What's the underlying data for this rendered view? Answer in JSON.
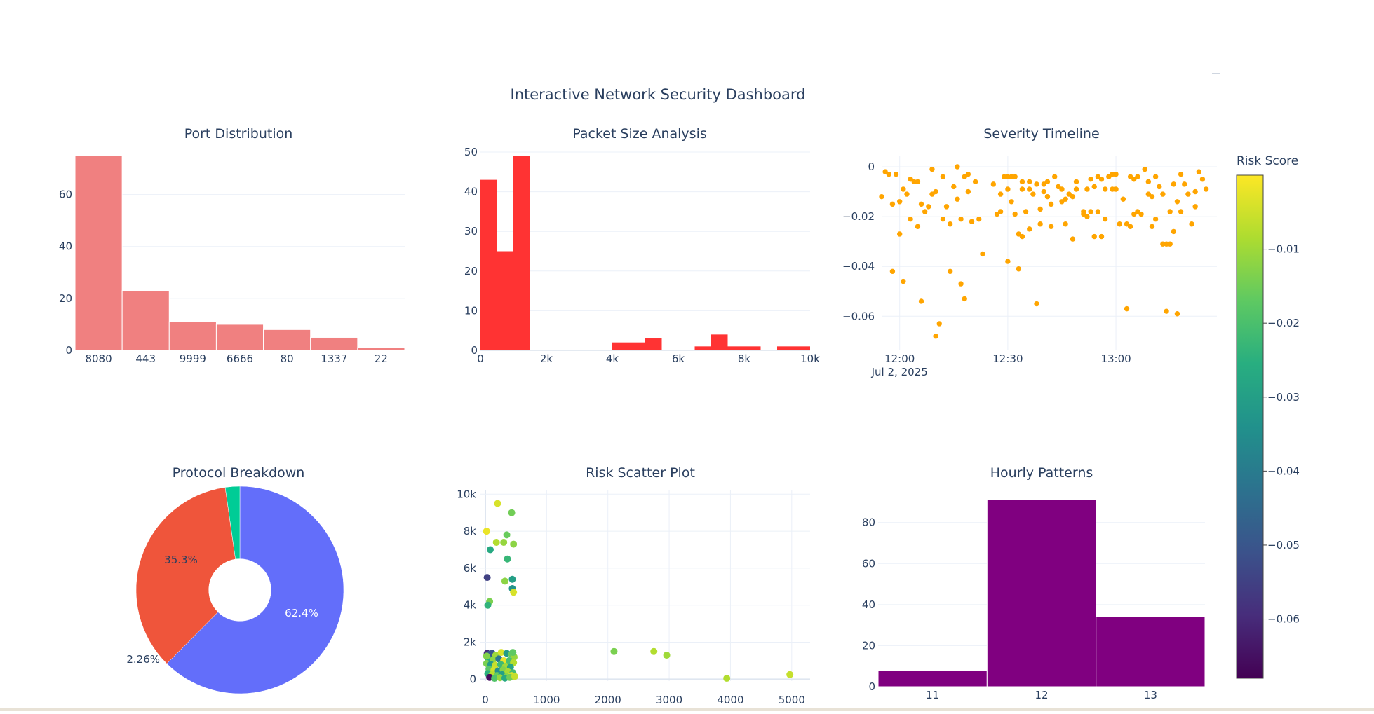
{
  "dashboard": {
    "title": "Interactive Network Security Dashboard",
    "colors": {
      "text": "#2a3f5f",
      "grid": "#ebf0f8",
      "port_bar": "#f08080",
      "packet_bar": "#ff3333",
      "severity_point": "orange",
      "hourly_bar": "purple",
      "pie": [
        "#636efa",
        "#ef553b",
        "#00cc96"
      ]
    }
  },
  "chart_data": [
    {
      "type": "bar",
      "title": "Port Distribution",
      "categories": [
        "8080",
        "443",
        "9999",
        "6666",
        "80",
        "1337",
        "22"
      ],
      "values": [
        75,
        23,
        11,
        10,
        8,
        5,
        1
      ],
      "yticks": [
        0,
        20,
        40,
        60
      ],
      "ylim": [
        0,
        75
      ],
      "grid": true
    },
    {
      "type": "bar",
      "subtype": "histogram",
      "title": "Packet Size Analysis",
      "bins": [
        {
          "x0": 0,
          "x1": 500,
          "y": 43
        },
        {
          "x0": 500,
          "x1": 1000,
          "y": 25
        },
        {
          "x0": 1000,
          "x1": 1500,
          "y": 49
        },
        {
          "x0": 4000,
          "x1": 5000,
          "y": 2
        },
        {
          "x0": 5000,
          "x1": 5500,
          "y": 3
        },
        {
          "x0": 6500,
          "x1": 7000,
          "y": 1
        },
        {
          "x0": 7000,
          "x1": 7500,
          "y": 4
        },
        {
          "x0": 7500,
          "x1": 8500,
          "y": 1
        },
        {
          "x0": 9000,
          "x1": 10000,
          "y": 1
        }
      ],
      "xticks": [
        0,
        2000,
        4000,
        6000,
        8000,
        10000
      ],
      "xtick_labels": [
        "0",
        "2k",
        "4k",
        "6k",
        "8k",
        "10k"
      ],
      "yticks": [
        0,
        10,
        20,
        30,
        40,
        50
      ],
      "xlim": [
        0,
        10000
      ],
      "ylim": [
        0,
        50
      ],
      "grid": true
    },
    {
      "type": "scatter",
      "title": "Severity Timeline",
      "x_axis": "time",
      "xtick_labels": [
        "12:00",
        "12:30",
        "13:00"
      ],
      "xtick_sub": "Jul 2, 2025",
      "xlim": [
        "11:55",
        "13:28"
      ],
      "ylim": [
        -0.0737,
        0.0045
      ],
      "yticks": [
        0,
        -0.02,
        -0.04,
        -0.06
      ],
      "ytick_labels": [
        "0",
        "−0.02",
        "−0.04",
        "−0.06"
      ],
      "grid": true,
      "points": [
        [
          "11:55",
          -0.012
        ],
        [
          "11:56",
          -0.002
        ],
        [
          "11:57",
          -0.003
        ],
        [
          "11:58",
          -0.042
        ],
        [
          "11:58",
          -0.015
        ],
        [
          "11:59",
          -0.003
        ],
        [
          "12:00",
          -0.014
        ],
        [
          "12:00",
          -0.027
        ],
        [
          "12:01",
          -0.046
        ],
        [
          "12:01",
          -0.009
        ],
        [
          "12:02",
          -0.011
        ],
        [
          "12:03",
          -0.021
        ],
        [
          "12:03",
          -0.005
        ],
        [
          "12:04",
          -0.006
        ],
        [
          "12:05",
          -0.024
        ],
        [
          "12:05",
          -0.006
        ],
        [
          "12:06",
          -0.054
        ],
        [
          "12:06",
          -0.015
        ],
        [
          "12:07",
          -0.018
        ],
        [
          "12:08",
          -0.016
        ],
        [
          "12:09",
          -0.001
        ],
        [
          "12:09",
          -0.011
        ],
        [
          "12:10",
          -0.01
        ],
        [
          "12:10",
          -0.068
        ],
        [
          "12:11",
          -0.063
        ],
        [
          "12:12",
          -0.021
        ],
        [
          "12:12",
          -0.004
        ],
        [
          "12:13",
          -0.016
        ],
        [
          "12:14",
          -0.023
        ],
        [
          "12:14",
          -0.042
        ],
        [
          "12:15",
          -0.008
        ],
        [
          "12:16",
          -0.0
        ],
        [
          "12:16",
          -0.013
        ],
        [
          "12:17",
          -0.047
        ],
        [
          "12:17",
          -0.021
        ],
        [
          "12:18",
          -0.004
        ],
        [
          "12:18",
          -0.053
        ],
        [
          "12:19",
          -0.01
        ],
        [
          "12:19",
          -0.003
        ],
        [
          "12:20",
          -0.022
        ],
        [
          "12:21",
          -0.006
        ],
        [
          "12:22",
          -0.021
        ],
        [
          "12:23",
          -0.035
        ],
        [
          "12:26",
          -0.007
        ],
        [
          "12:27",
          -0.019
        ],
        [
          "12:28",
          -0.011
        ],
        [
          "12:28",
          -0.018
        ],
        [
          "12:29",
          -0.004
        ],
        [
          "12:30",
          -0.009
        ],
        [
          "12:30",
          -0.038
        ],
        [
          "12:30",
          -0.004
        ],
        [
          "12:31",
          -0.014
        ],
        [
          "12:31",
          -0.004
        ],
        [
          "12:32",
          -0.004
        ],
        [
          "12:32",
          -0.019
        ],
        [
          "12:33",
          -0.027
        ],
        [
          "12:33",
          -0.041
        ],
        [
          "12:34",
          -0.009
        ],
        [
          "12:34",
          -0.028
        ],
        [
          "12:34",
          -0.006
        ],
        [
          "12:35",
          -0.018
        ],
        [
          "12:36",
          -0.009
        ],
        [
          "12:36",
          -0.025
        ],
        [
          "12:36",
          -0.006
        ],
        [
          "12:37",
          -0.011
        ],
        [
          "12:38",
          -0.055
        ],
        [
          "12:38",
          -0.007
        ],
        [
          "12:39",
          -0.017
        ],
        [
          "12:39",
          -0.023
        ],
        [
          "12:40",
          -0.01
        ],
        [
          "12:40",
          -0.007
        ],
        [
          "12:41",
          -0.006
        ],
        [
          "12:41",
          -0.012
        ],
        [
          "12:42",
          -0.024
        ],
        [
          "12:42",
          -0.015
        ],
        [
          "12:43",
          -0.004
        ],
        [
          "12:44",
          -0.008
        ],
        [
          "12:45",
          -0.014
        ],
        [
          "12:45",
          -0.009
        ],
        [
          "12:46",
          -0.023
        ],
        [
          "12:46",
          -0.013
        ],
        [
          "12:47",
          -0.011
        ],
        [
          "12:48",
          -0.012
        ],
        [
          "12:48",
          -0.029
        ],
        [
          "12:49",
          -0.009
        ],
        [
          "12:49",
          -0.006
        ],
        [
          "12:51",
          -0.019
        ],
        [
          "12:51",
          -0.018
        ],
        [
          "12:52",
          -0.02
        ],
        [
          "12:52",
          -0.009
        ],
        [
          "12:53",
          -0.005
        ],
        [
          "12:53",
          -0.018
        ],
        [
          "12:54",
          -0.008
        ],
        [
          "12:54",
          -0.028
        ],
        [
          "12:55",
          -0.004
        ],
        [
          "12:55",
          -0.018
        ],
        [
          "12:56",
          -0.028
        ],
        [
          "12:56",
          -0.005
        ],
        [
          "12:57",
          -0.021
        ],
        [
          "12:57",
          -0.009
        ],
        [
          "12:58",
          -0.004
        ],
        [
          "12:59",
          -0.009
        ],
        [
          "12:59",
          -0.003
        ],
        [
          "13:00",
          -0.003
        ],
        [
          "13:00",
          -0.009
        ],
        [
          "13:01",
          -0.023
        ],
        [
          "13:02",
          -0.013
        ],
        [
          "13:03",
          -0.023
        ],
        [
          "13:03",
          -0.057
        ],
        [
          "13:04",
          -0.024
        ],
        [
          "13:04",
          -0.004
        ],
        [
          "13:05",
          -0.019
        ],
        [
          "13:05",
          -0.005
        ],
        [
          "13:06",
          -0.004
        ],
        [
          "13:06",
          -0.018
        ],
        [
          "13:07",
          -0.019
        ],
        [
          "13:08",
          -0.001
        ],
        [
          "13:09",
          -0.011
        ],
        [
          "13:09",
          -0.006
        ],
        [
          "13:10",
          -0.012
        ],
        [
          "13:10",
          -0.024
        ],
        [
          "13:11",
          -0.021
        ],
        [
          "13:11",
          -0.004
        ],
        [
          "13:12",
          -0.008
        ],
        [
          "13:13",
          -0.011
        ],
        [
          "13:13",
          -0.031
        ],
        [
          "13:14",
          -0.031
        ],
        [
          "13:14",
          -0.058
        ],
        [
          "13:15",
          -0.018
        ],
        [
          "13:15",
          -0.031
        ],
        [
          "13:16",
          -0.026
        ],
        [
          "13:16",
          -0.007
        ],
        [
          "13:17",
          -0.059
        ],
        [
          "13:17",
          -0.014
        ],
        [
          "13:18",
          -0.018
        ],
        [
          "13:18",
          -0.003
        ],
        [
          "13:19",
          -0.007
        ],
        [
          "13:20",
          -0.011
        ],
        [
          "13:21",
          -0.023
        ],
        [
          "13:22",
          -0.016
        ],
        [
          "13:22",
          -0.01
        ],
        [
          "13:23",
          -0.002
        ],
        [
          "13:24",
          -0.005
        ],
        [
          "13:25",
          -0.009
        ]
      ]
    },
    {
      "type": "pie",
      "title": "Protocol Breakdown",
      "hole": 0.3,
      "labels": [
        "62.4%",
        "35.3%",
        "2.26%"
      ],
      "values": [
        62.4,
        35.3,
        2.26
      ]
    },
    {
      "type": "scatter",
      "title": "Risk Scatter Plot",
      "xticks": [
        0,
        1000,
        2000,
        3000,
        4000,
        5000
      ],
      "xtick_labels": [
        "0",
        "1000",
        "2000",
        "3000",
        "4000",
        "5000"
      ],
      "yticks": [
        0,
        2000,
        4000,
        6000,
        8000,
        10000
      ],
      "ytick_labels": [
        "0",
        "2k",
        "4k",
        "6k",
        "8k",
        "10k"
      ],
      "xlim": [
        -80,
        5300
      ],
      "ylim": [
        -100,
        10200
      ],
      "grid": true,
      "colorscale": "Viridis",
      "colorbar": {
        "title": "Risk Score",
        "range": [
          -0.068,
          0.0
        ],
        "ticks": [
          -0.01,
          -0.02,
          -0.03,
          -0.04,
          -0.05,
          -0.06
        ],
        "tick_labels": [
          "−0.01",
          "−0.02",
          "−0.03",
          "−0.04",
          "−0.05",
          "−0.06"
        ]
      },
      "points": [
        [
          200,
          9500,
          -0.004
        ],
        [
          430,
          9000,
          -0.015
        ],
        [
          20,
          8000,
          -0.002
        ],
        [
          350,
          7800,
          -0.016
        ],
        [
          180,
          7400,
          -0.008
        ],
        [
          300,
          7400,
          -0.011
        ],
        [
          460,
          7300,
          -0.012
        ],
        [
          80,
          7000,
          -0.027
        ],
        [
          360,
          6500,
          -0.023
        ],
        [
          30,
          5500,
          -0.055
        ],
        [
          320,
          5300,
          -0.012
        ],
        [
          440,
          5400,
          -0.03
        ],
        [
          440,
          4900,
          -0.033
        ],
        [
          460,
          4700,
          -0.004
        ],
        [
          70,
          4200,
          -0.014
        ],
        [
          40,
          4000,
          -0.024
        ],
        [
          2100,
          1500,
          -0.014
        ],
        [
          2750,
          1500,
          -0.008
        ],
        [
          2960,
          1300,
          -0.01
        ],
        [
          3940,
          50,
          -0.008
        ],
        [
          4970,
          250,
          -0.006
        ],
        [
          30,
          1400,
          -0.06
        ],
        [
          70,
          1350,
          -0.048
        ],
        [
          110,
          1400,
          -0.05
        ],
        [
          170,
          1300,
          -0.01
        ],
        [
          260,
          1450,
          -0.004
        ],
        [
          350,
          1400,
          -0.031
        ],
        [
          430,
          1350,
          -0.016
        ],
        [
          470,
          1200,
          -0.011
        ],
        [
          50,
          1100,
          -0.026
        ],
        [
          130,
          1050,
          -0.012
        ],
        [
          220,
          1100,
          -0.041
        ],
        [
          300,
          1000,
          -0.002
        ],
        [
          390,
          1000,
          -0.02
        ],
        [
          460,
          900,
          -0.008
        ],
        [
          20,
          850,
          -0.014
        ],
        [
          90,
          800,
          -0.031
        ],
        [
          160,
          750,
          -0.006
        ],
        [
          250,
          800,
          -0.022
        ],
        [
          330,
          700,
          -0.01
        ],
        [
          410,
          650,
          -0.028
        ],
        [
          60,
          550,
          -0.018
        ],
        [
          140,
          500,
          -0.005
        ],
        [
          210,
          450,
          -0.035
        ],
        [
          290,
          500,
          -0.013
        ],
        [
          370,
          400,
          -0.009
        ],
        [
          450,
          350,
          -0.021
        ],
        [
          40,
          300,
          -0.025
        ],
        [
          110,
          250,
          -0.007
        ],
        [
          190,
          200,
          -0.016
        ],
        [
          270,
          250,
          -0.03
        ],
        [
          350,
          150,
          -0.012
        ],
        [
          430,
          200,
          -0.004
        ],
        [
          70,
          100,
          -0.066
        ],
        [
          150,
          50,
          -0.019
        ],
        [
          240,
          80,
          -0.011
        ],
        [
          320,
          60,
          -0.027
        ],
        [
          400,
          100,
          -0.015
        ],
        [
          480,
          150,
          -0.006
        ],
        [
          20,
          1250,
          -0.013
        ],
        [
          450,
          1450,
          -0.017
        ]
      ]
    },
    {
      "type": "bar",
      "title": "Hourly Patterns",
      "categories": [
        "11",
        "12",
        "13"
      ],
      "values": [
        8,
        91,
        34
      ],
      "yticks": [
        0,
        20,
        40,
        60,
        80
      ],
      "ylim": [
        0,
        95.6
      ],
      "grid": true
    }
  ]
}
